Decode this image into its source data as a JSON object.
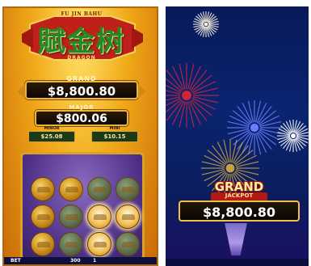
{
  "left_screen": {
    "logo": {
      "top_text": "FU JIN BAHU",
      "chinese_chars": "賦金树",
      "subtitle": "DRAGON"
    },
    "grand": {
      "label": "GRAND",
      "value": "$8,800.80"
    },
    "major": {
      "label": "MAJOR",
      "value": "$800.06"
    },
    "minor": {
      "label": "MINOR",
      "value": "$25.08"
    },
    "mini": {
      "label": "MINI",
      "value": "$10.15"
    },
    "coins": [
      "gold",
      "gold",
      "dim",
      "dim",
      "gold",
      "dim",
      "lit",
      "lit",
      "gold",
      "dim",
      "lit",
      "dim"
    ],
    "footer": {
      "left": "BET",
      "mid": "300",
      "right": "1"
    }
  },
  "right_screen": {
    "jackpot_title": "GRAND",
    "jackpot_sub": "JACKPOT",
    "jackpot_value": "$8,800.80"
  },
  "colors": {
    "gold": "#f0a818",
    "purple": "#4c2e86",
    "night_blue": "#0a2470",
    "green_text": "#1f8a2a"
  }
}
